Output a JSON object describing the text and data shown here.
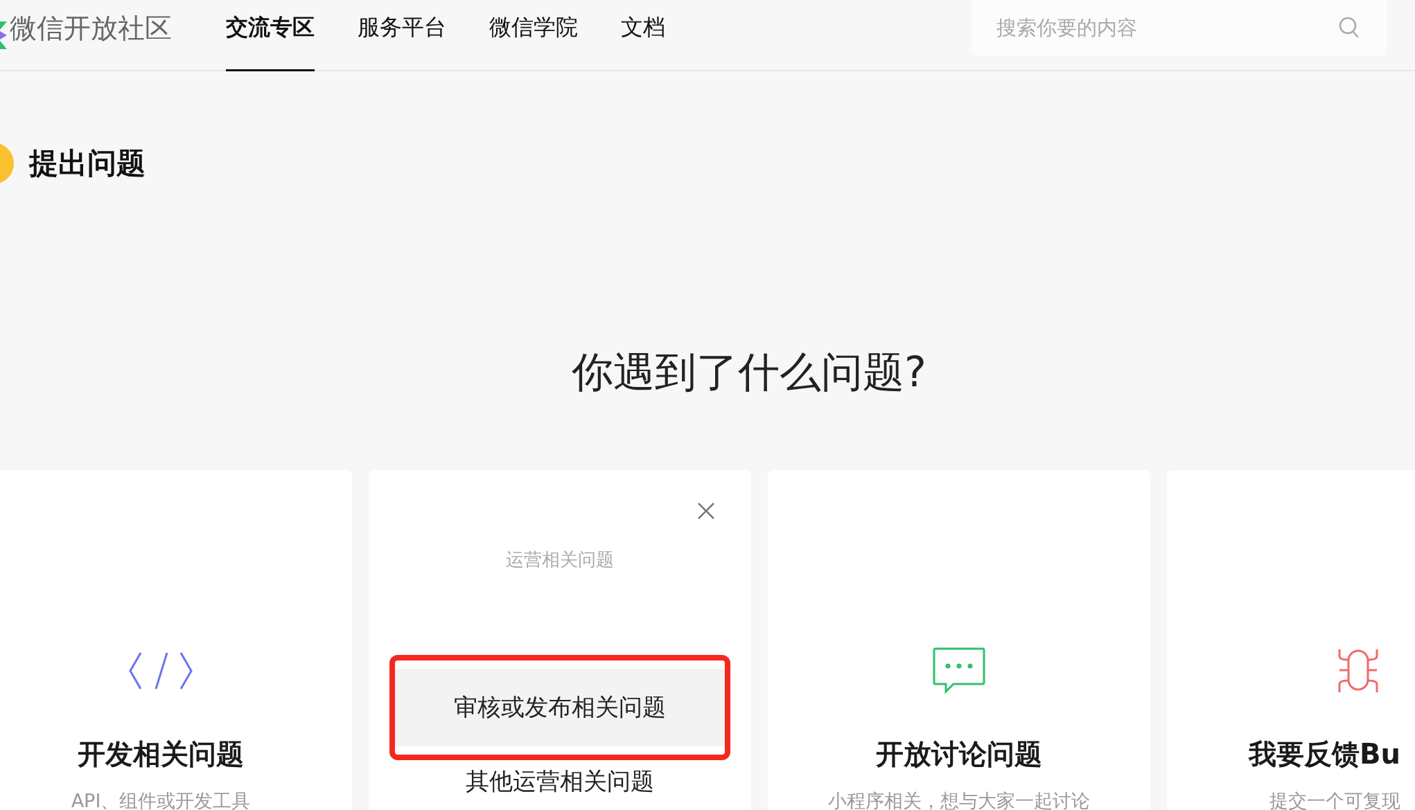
{
  "logo": {
    "text": "微信开放社区"
  },
  "nav": [
    {
      "label": "交流专区",
      "selected": true
    },
    {
      "label": "服务平台",
      "selected": false
    },
    {
      "label": "微信学院",
      "selected": false
    },
    {
      "label": "文档",
      "selected": false
    }
  ],
  "search": {
    "placeholder": "搜索你要的内容"
  },
  "page_title": "提出问题",
  "heading": "你遇到了什么问题?",
  "cards": [
    {
      "kind": "code",
      "title": "开发相关问题",
      "subtitle": "API、组件或开发工具"
    },
    {
      "kind": "menu",
      "caption": "运营相关问题",
      "options": [
        {
          "label": "审核或发布相关问题",
          "selected": true,
          "marked": true
        },
        {
          "label": "其他运营相关问题",
          "selected": false,
          "marked": false
        }
      ]
    },
    {
      "kind": "chat",
      "title": "开放讨论问题",
      "subtitle": "小程序相关，想与大家一起讨论"
    },
    {
      "kind": "bug",
      "title": "我要反馈Bu",
      "subtitle": "提交一个可复现"
    }
  ]
}
